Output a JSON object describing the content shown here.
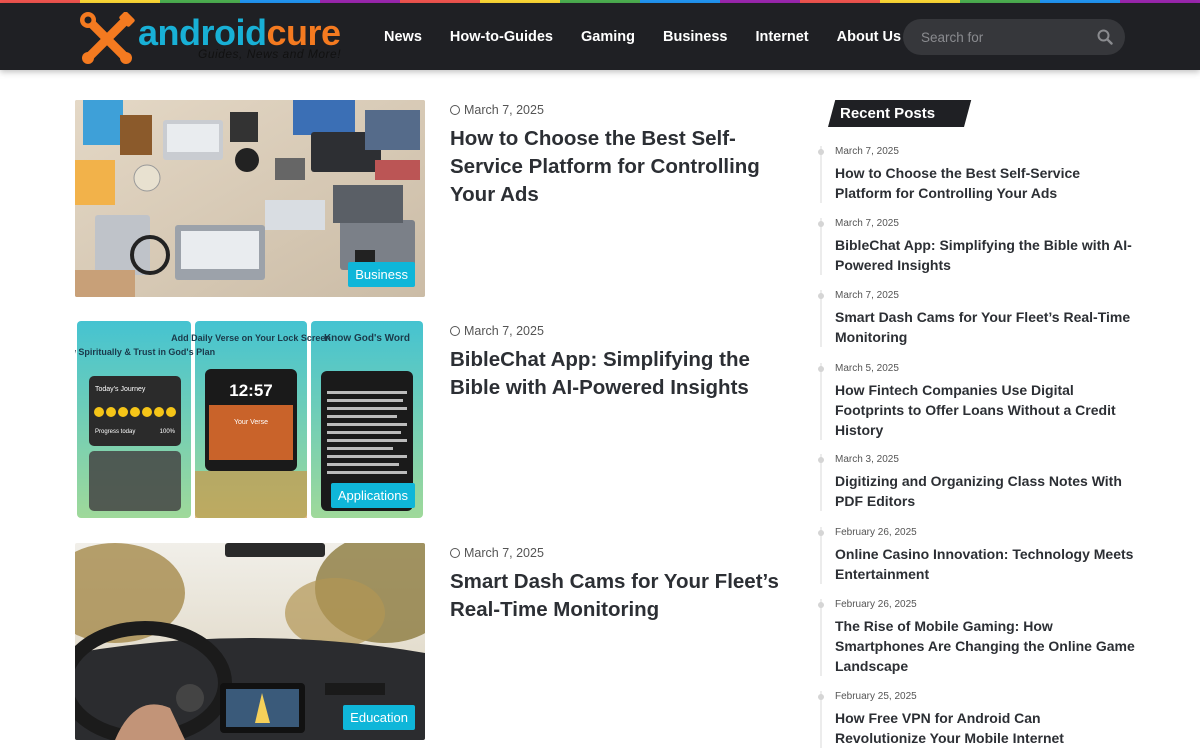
{
  "colors": {
    "rainbow": [
      "#f0544f",
      "#fdd835",
      "#4caf50",
      "#2196f3",
      "#9c27b0",
      "#f0544f",
      "#fdd835",
      "#4caf50",
      "#2196f3",
      "#9c27b0",
      "#f0544f",
      "#fdd835",
      "#4caf50",
      "#2196f3",
      "#9c27b0"
    ],
    "accent": "#0fb6d9",
    "header_bg": "#1f2024"
  },
  "logo": {
    "part1": "android",
    "part2": "cure",
    "tagline": "Guides, News and More!"
  },
  "nav": [
    {
      "label": "News"
    },
    {
      "label": "How-to-Guides"
    },
    {
      "label": "Gaming"
    },
    {
      "label": "Business"
    },
    {
      "label": "Internet"
    },
    {
      "label": "About Us"
    }
  ],
  "search": {
    "placeholder": "Search for",
    "icon": "search-icon"
  },
  "posts": [
    {
      "date": "March 7, 2025",
      "title": "How to Choose the Best Self-Service Platform for Controlling Your Ads",
      "category": "Business"
    },
    {
      "date": "March 7, 2025",
      "title": "BibleChat App: Simplifying the Bible with AI-Powered Insights",
      "category": "Applications"
    },
    {
      "date": "March 7, 2025",
      "title": "Smart Dash Cams for Your Fleet’s Real-Time Monitoring",
      "category": "Education"
    }
  ],
  "bible_thumb": {
    "panel1": "Grow Spiritually & Trust in God's Plan",
    "panel1_journey": "Today's Journey",
    "panel1_progress": "Progress today",
    "panel1_percent": "100%",
    "panel2": "Add Daily Verse on Your Lock Screen",
    "panel2_time": "12:57",
    "panel2_verse": "Your Verse",
    "panel3": "Know God's Word"
  },
  "sidebar": {
    "title": "Recent Posts",
    "items": [
      {
        "date": "March 7, 2025",
        "title": "How to Choose the Best Self-Service Platform for Controlling Your Ads"
      },
      {
        "date": "March 7, 2025",
        "title": "BibleChat App: Simplifying the Bible with AI-Powered Insights"
      },
      {
        "date": "March 7, 2025",
        "title": "Smart Dash Cams for Your Fleet’s Real-Time Monitoring"
      },
      {
        "date": "March 5, 2025",
        "title": "How Fintech Companies Use Digital Footprints to Offer Loans Without a Credit History"
      },
      {
        "date": "March 3, 2025",
        "title": "Digitizing and Organizing Class Notes With PDF Editors"
      },
      {
        "date": "February 26, 2025",
        "title": "Online Casino Innovation: Technology Meets Entertainment"
      },
      {
        "date": "February 26, 2025",
        "title": "The Rise of Mobile Gaming: How Smartphones Are Changing the Online Game Landscape"
      },
      {
        "date": "February 25, 2025",
        "title": "How Free VPN for Android Can Revolutionize Your Mobile Internet"
      }
    ]
  }
}
